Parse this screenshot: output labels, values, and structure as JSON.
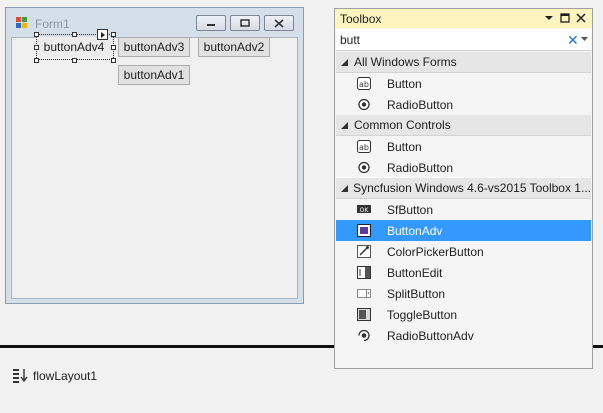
{
  "form": {
    "title": "Form1",
    "buttons": {
      "b4": "buttonAdv4",
      "b3": "buttonAdv3",
      "b2": "buttonAdv2",
      "b1": "buttonAdv1"
    }
  },
  "tray": {
    "component_label": "flowLayout1"
  },
  "toolbox": {
    "title": "Toolbox",
    "search_value": "butt",
    "groups": [
      {
        "name": "All Windows Forms",
        "items": [
          {
            "label": "Button",
            "icon": "button-icon"
          },
          {
            "label": "RadioButton",
            "icon": "radio-button-icon"
          }
        ]
      },
      {
        "name": "Common Controls",
        "items": [
          {
            "label": "Button",
            "icon": "button-icon"
          },
          {
            "label": "RadioButton",
            "icon": "radio-button-icon"
          }
        ]
      },
      {
        "name": "Syncfusion Windows 4.6-vs2015 Toolbox 1...",
        "items": [
          {
            "label": "SfButton",
            "icon": "sf-button-icon"
          },
          {
            "label": "ButtonAdv",
            "icon": "button-adv-icon",
            "selected": true
          },
          {
            "label": "ColorPickerButton",
            "icon": "color-picker-icon"
          },
          {
            "label": "ButtonEdit",
            "icon": "button-edit-icon"
          },
          {
            "label": "SplitButton",
            "icon": "split-button-icon"
          },
          {
            "label": "ToggleButton",
            "icon": "toggle-button-icon"
          },
          {
            "label": "RadioButtonAdv",
            "icon": "radio-button-adv-icon"
          }
        ]
      }
    ]
  },
  "colors": {
    "selection": "#3399ff",
    "toolbox_header": "#fdf4bf",
    "form_frame": "#d5dfe9"
  }
}
